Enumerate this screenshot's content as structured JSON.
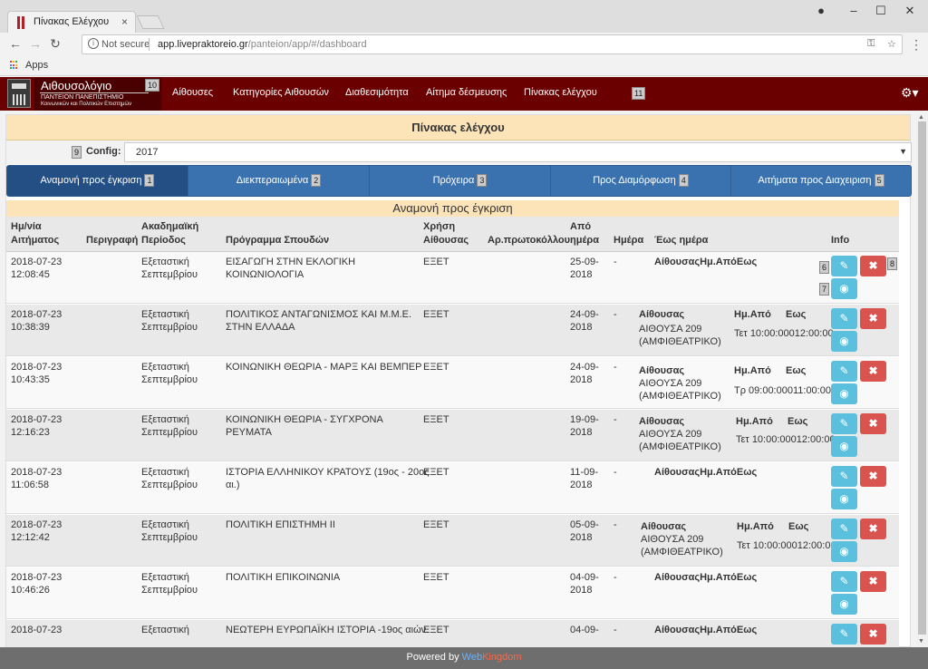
{
  "browser": {
    "tab_title": "Πίνακας Ελέγχου",
    "close": "×",
    "not_secure": "Not secure",
    "url_host": "app.livepraktoreio.gr",
    "url_path": "/panteion/app/#/dashboard",
    "bookmark_apps": "Apps"
  },
  "app": {
    "logo_title": "Αιθουσολόγιο",
    "logo_sub1": "ΠΑΝΤΕΙΟΝ ΠΑΝΕΠΙΣΤΗΜΙΟ",
    "logo_sub2": "Κοινωνικών και Πολιτικών Επιστημών",
    "logo_badge": "10",
    "nav": [
      "Αίθουσες",
      "Κατηγορίες Αιθουσών",
      "Διαθεσιμότητα",
      "Αίτημα δέσμευσης",
      "Πίνακας ελέγχου"
    ],
    "nav_badge": "11"
  },
  "panel": {
    "title": "Πίνακας ελέγχου",
    "config_badge": "9",
    "config_label": "Config:",
    "config_value": "2017"
  },
  "tabs": [
    {
      "label": "Αναμονή προς έγκριση",
      "badge": "1"
    },
    {
      "label": "Διεκπεραιωμένα",
      "badge": "2"
    },
    {
      "label": "Πρόχειρα",
      "badge": "3"
    },
    {
      "label": "Προς Διαμόρφωση",
      "badge": "4"
    },
    {
      "label": "Αιτήματα προς Διαχειριση",
      "badge": "5"
    }
  ],
  "section_title": "Αναμονή προς έγκριση",
  "columns": {
    "date": [
      "Ημ/νία",
      "Αιτήματος"
    ],
    "desc": "Περιγραφή",
    "period": [
      "Ακαδημαϊκή",
      "Περίοδος"
    ],
    "program": "Πρόγραμμα Σπουδών",
    "use": [
      "Χρήση",
      "Αίθουσας"
    ],
    "protocol": "Αρ.πρωτοκόλλου",
    "from": [
      "Από",
      "ημέρα"
    ],
    "day": "Ημέρα",
    "until": "Έως ημέρα",
    "info": "Info"
  },
  "rows": [
    {
      "date": "2018-07-23",
      "time": "12:08:45",
      "period1": "Εξεταστική",
      "period2": "Σεπτεμβρίου",
      "program1": "ΕΙΣΑΓΩΓΗ ΣΤΗΝ ΕΚΛΟΓΙΚΗ",
      "program2": "ΚΟΙΝΩΝΙΟΛΟΓΙΑ",
      "use": "ΕΞΕΤ",
      "from1": "25-09-",
      "from2": "2018",
      "day": "-",
      "detail_merged": "ΑίθουσαςΗμ.ΑπόΕως",
      "badge_edit": "6",
      "badge_view": "7",
      "badge_del": "8"
    },
    {
      "date": "2018-07-23",
      "time": "10:38:39",
      "period1": "Εξεταστική",
      "period2": "Σεπτεμβρίου",
      "program1": "ΠΟΛΙΤΙΚΟΣ ΑΝΤΑΓΩΝΙΣΜΟΣ ΚΑΙ Μ.Μ.Ε.",
      "program2": "ΣΤΗΝ ΕΛΛΑΔΑ",
      "use": "ΕΞΕΤ",
      "from1": "24-09-",
      "from2": "2018",
      "day": "-",
      "room_h": "Αίθουσας",
      "room1": "ΑΙΘΟΥΣΑ 209",
      "room2": "(ΑΜΦΙΘΕΑΤΡΙΚΟ)",
      "hfrom": "Ημ.Από",
      "hto": "Εως",
      "sched": "Τετ 10:00:00012:00:00"
    },
    {
      "date": "2018-07-23",
      "time": "10:43:35",
      "period1": "Εξεταστική",
      "period2": "Σεπτεμβρίου",
      "program1": "ΚΟΙΝΩΝΙΚΗ ΘΕΩΡΙΑ - ΜΑΡΞ ΚΑΙ ΒΕΜΠΕΡ",
      "program2": "",
      "use": "ΕΞΕΤ",
      "from1": "24-09-",
      "from2": "2018",
      "day": "-",
      "room_h": "Αίθουσας",
      "room1": "ΑΙΘΟΥΣΑ 209",
      "room2": "(ΑΜΦΙΘΕΑΤΡΙΚΟ)",
      "hfrom": "Ημ.Από",
      "hto": "Εως",
      "sched": "Τρ 09:00:00011:00:00"
    },
    {
      "date": "2018-07-23",
      "time": "12:16:23",
      "period1": "Εξεταστική",
      "period2": "Σεπτεμβρίου",
      "program1": "ΚΟΙΝΩΝΙΚΗ ΘΕΩΡΙΑ - ΣΥΓΧΡΟΝΑ",
      "program2": "ΡΕΥΜΑΤΑ",
      "use": "ΕΞΕΤ",
      "from1": "19-09-",
      "from2": "2018",
      "day": "-",
      "room_h": "Αίθουσας",
      "room1": "ΑΙΘΟΥΣΑ 209",
      "room2": "(ΑΜΦΙΘΕΑΤΡΙΚΟ)",
      "hfrom": "Ημ.Από",
      "hto": "Εως",
      "sched": "Τετ 10:00:00012:00:00"
    },
    {
      "date": "2018-07-23",
      "time": "11:06:58",
      "period1": "Εξεταστική",
      "period2": "Σεπτεμβρίου",
      "program1": "ΙΣΤΟΡΙΑ ΕΛΛΗΝΙΚΟΥ ΚΡΑΤΟΥΣ (19ος - 20ος",
      "program2": "αι.)",
      "use": "ΕΞΕΤ",
      "from1": "11-09-",
      "from2": "2018",
      "day": "-",
      "detail_merged": "ΑίθουσαςΗμ.ΑπόΕως"
    },
    {
      "date": "2018-07-23",
      "time": "12:12:42",
      "period1": "Εξεταστική",
      "period2": "Σεπτεμβρίου",
      "program1": "ΠΟΛΙΤΙΚΗ ΕΠΙΣΤΗΜΗ ΙΙ",
      "program2": "",
      "use": "ΕΞΕΤ",
      "from1": "05-09-",
      "from2": "2018",
      "day": "-",
      "room_h": "Αίθουσας",
      "room1": "ΑΙΘΟΥΣΑ 209",
      "room2": "(ΑΜΦΙΘΕΑΤΡΙΚΟ)",
      "hfrom": "Ημ.Από",
      "hto": "Εως",
      "sched": "Τετ 10:00:00012:00:00"
    },
    {
      "date": "2018-07-23",
      "time": "10:46:26",
      "period1": "Εξεταστική",
      "period2": "Σεπτεμβρίου",
      "program1": "ΠΟΛΙΤΙΚΗ ΕΠΙΚΟΙΝΩΝΙΑ",
      "program2": "",
      "use": "ΕΞΕΤ",
      "from1": "04-09-",
      "from2": "2018",
      "day": "-",
      "detail_merged": "ΑίθουσαςΗμ.ΑπόΕως"
    },
    {
      "date": "2018-07-23",
      "time": "",
      "period1": "Εξεταστική",
      "period2": "",
      "program1": "ΝΕΩΤΕΡΗ ΕΥΡΩΠΑΪΚΗ ΙΣΤΟΡΙΑ -19ος αιών.",
      "program2": "",
      "use": "ΕΞΕΤ",
      "from1": "04-09-",
      "from2": "",
      "day": "-",
      "detail_merged": "ΑίθουσαςΗμ.ΑπόΕως"
    }
  ],
  "footer": {
    "prefix": "Powered by",
    "brand1": "Web",
    "brand2": "Kingdom"
  },
  "colors": {
    "navbar": "#6b0000",
    "tabs": "#3a72b0",
    "panel_head": "#fce4b8",
    "btn_info": "#5bc0de",
    "btn_danger": "#d9534f"
  }
}
